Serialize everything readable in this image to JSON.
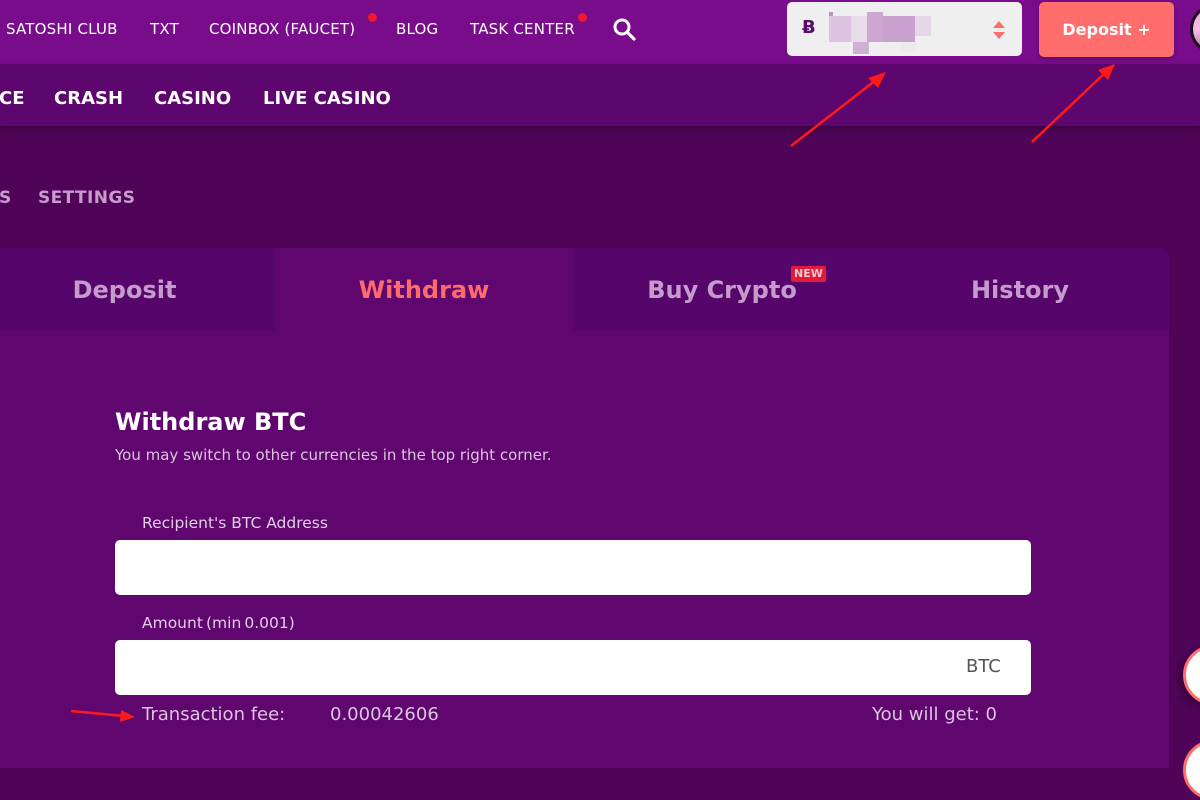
{
  "top_nav": {
    "items": [
      {
        "label": "SATOSHI CLUB",
        "has_notification": false
      },
      {
        "label": "TXT",
        "has_notification": false
      },
      {
        "label": "COINBOX (FAUCET)",
        "has_notification": true
      },
      {
        "label": "BLOG",
        "has_notification": false
      },
      {
        "label": "TASK CENTER",
        "has_notification": true
      }
    ],
    "search_icon": "search-icon",
    "currency_selector": {
      "currency_symbol": "Ƀ",
      "balance_display": "blurred",
      "icon": "sort-updown-icon"
    },
    "deposit_button_label": "Deposit +",
    "avatar": "user-avatar"
  },
  "game_nav": {
    "items": [
      {
        "label": "CE"
      },
      {
        "label": "CRASH"
      },
      {
        "label": "CASINO"
      },
      {
        "label": "LIVE CASINO"
      }
    ]
  },
  "sub_nav": {
    "items": [
      {
        "label": "S"
      },
      {
        "label": "SETTINGS"
      }
    ]
  },
  "wallet_tabs": [
    {
      "label": "Deposit",
      "active": false
    },
    {
      "label": "Withdraw",
      "active": true
    },
    {
      "label": "Buy Crypto",
      "active": false,
      "badge": "NEW"
    },
    {
      "label": "History",
      "active": false
    }
  ],
  "withdraw_form": {
    "title": "Withdraw BTC",
    "subtitle": "You may switch to other currencies in the top right corner.",
    "address_field": {
      "label": "Recipient's BTC Address",
      "value": "",
      "placeholder": ""
    },
    "amount_field": {
      "label": "Amount (min 0.001)",
      "value": "",
      "placeholder": "",
      "suffix": "BTC"
    },
    "transaction_fee_label": "Transaction fee:",
    "transaction_fee_value": "0.00042606",
    "you_will_get": "You will get: 0"
  },
  "colors": {
    "topbar": "#780c8a",
    "gamebar": "#5d066e",
    "background": "#4f0458",
    "panel": "#5f066f",
    "accent": "#ff6d6d",
    "new_badge": "#e21b3a",
    "annotation_arrow": "#ff1a1a"
  }
}
